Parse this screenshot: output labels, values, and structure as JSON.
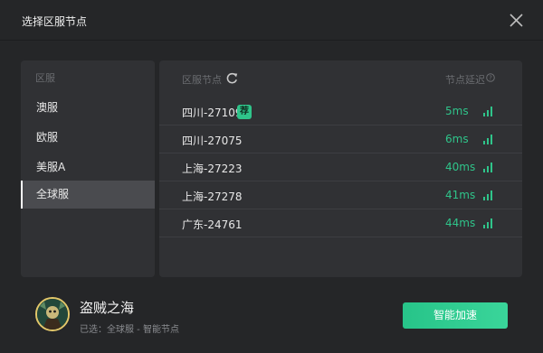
{
  "window": {
    "title": "选择区服节点"
  },
  "regions": {
    "header": "区服",
    "items": [
      {
        "label": "澳服"
      },
      {
        "label": "欧服"
      },
      {
        "label": "美服A"
      },
      {
        "label": "全球服"
      }
    ],
    "selected_index": 3
  },
  "nodes": {
    "header_name": "区服节点",
    "header_latency": "节点延迟",
    "recommended_badge": "荐",
    "rows": [
      {
        "name": "四川-27109",
        "latency": "5ms",
        "recommended": true
      },
      {
        "name": "四川-27075",
        "latency": "6ms",
        "recommended": false
      },
      {
        "name": "上海-27223",
        "latency": "40ms",
        "recommended": false
      },
      {
        "name": "上海-27278",
        "latency": "41ms",
        "recommended": false
      },
      {
        "name": "广东-24761",
        "latency": "44ms",
        "recommended": false
      }
    ]
  },
  "footer": {
    "game_name": "盗贼之海",
    "selected_info": "已选：全球服 - 智能节点",
    "accelerate_label": "智能加速"
  },
  "colors": {
    "accent_green": "#2fc48a",
    "background": "#252628",
    "panel": "#303134",
    "active_region": "#4a4b4f"
  },
  "icons": {
    "close": "close-icon",
    "refresh": "refresh-icon",
    "help": "question-circle-icon",
    "signal": "signal-bars-icon"
  }
}
